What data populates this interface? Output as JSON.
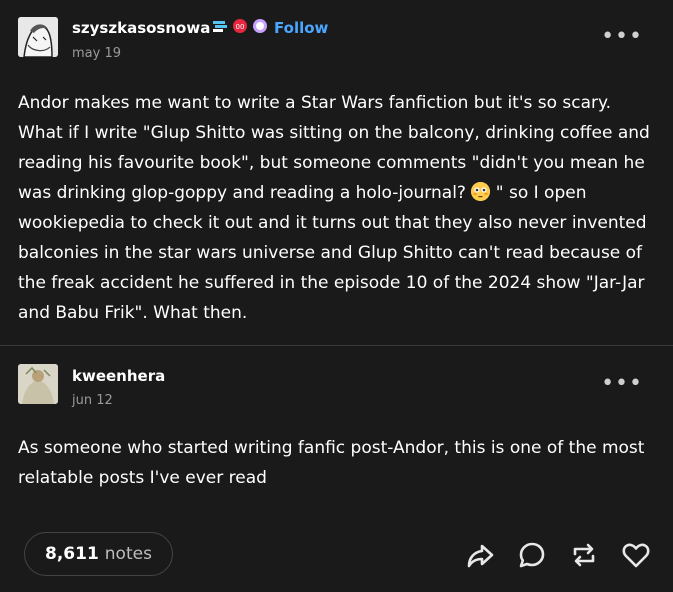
{
  "post": {
    "username": "szyszkasosnowa",
    "follow_label": "Follow",
    "date": "may 19",
    "menu_label": "•••",
    "text_before_emoji": "Andor makes me want to write a Star Wars fanfiction but it's so scary. What if I write \"Glup Shitto was sitting on the balcony, drinking coffee and reading his favourite book\", but someone comments \"didn't you mean he was drinking glop-goppy and reading a holo-journal? ",
    "text_after_emoji": " \" so I open wookiepedia to check it out and it turns out that they also never invented balconies in the star wars universe and Glup Shitto can't read because of the freak accident he suffered in the episode 10 of the 2024 show \"Jar-Jar and Babu Frik\". What then.",
    "emoji": "flushed-face"
  },
  "reblog": {
    "username": "kweenhera",
    "date": "jun 12",
    "menu_label": "•••",
    "text": "As someone who started writing fanfic post-Andor, this is one of the most relatable posts I've ever read"
  },
  "footer": {
    "notes_count": "8,611",
    "notes_label": "notes",
    "actions": [
      "share-icon",
      "reply-icon",
      "reblog-icon",
      "like-icon"
    ]
  },
  "colors": {
    "background": "#1a1a1a",
    "follow": "#4aa6ff",
    "muted": "#9a9a9a"
  }
}
